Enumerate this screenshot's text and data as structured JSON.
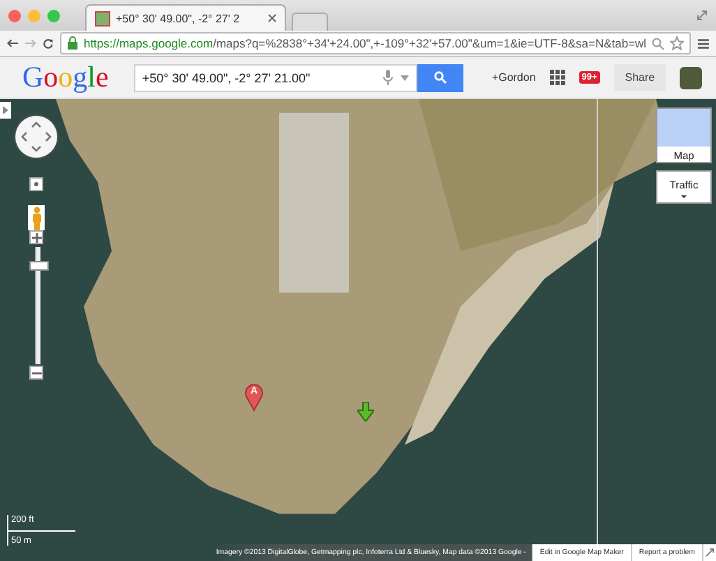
{
  "browser": {
    "tab_title": "+50° 30' 49.00\", -2° 27' 2",
    "url_host": "https://maps.google.com",
    "url_path": "/maps?q=%2838°+34'+24.00\",+-109°+32'+57.00\"&um=1&ie=UTF-8&sa=N&tab=wl"
  },
  "header": {
    "logo": "Google",
    "search_value": "+50° 30' 49.00\", -2° 27' 21.00\"",
    "user": "+Gordon",
    "notification_count": "99+",
    "share": "Share"
  },
  "map": {
    "zoom": {
      "level": 0.85
    },
    "layer_buttons": [
      {
        "label": "Map"
      },
      {
        "label": "Traffic"
      }
    ],
    "scale": [
      "200 ft",
      "50 m"
    ],
    "marker": {
      "label": "A"
    },
    "attribution": "Imagery ©2013 DigitalGlobe, Getmapping plc, Infoterra Ltd & Bluesky, Map data ©2013 Google -",
    "links": [
      "Edit in Google Map Maker",
      "Report a problem"
    ]
  }
}
